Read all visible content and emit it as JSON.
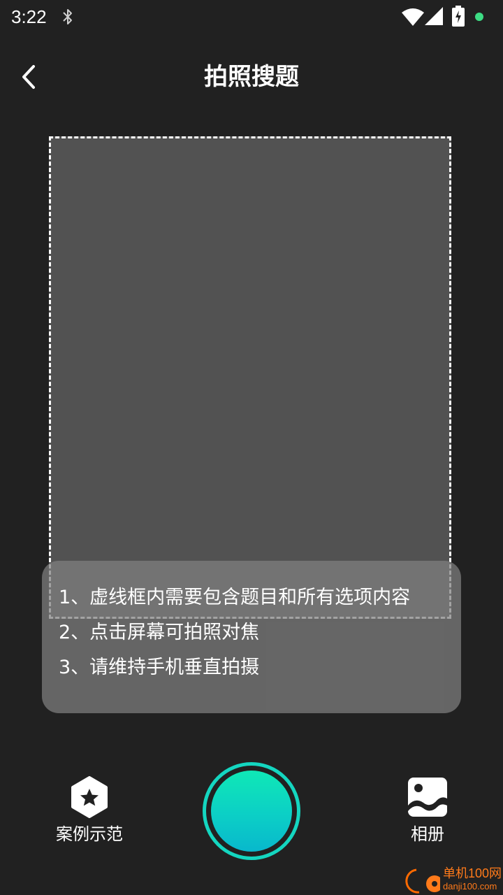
{
  "status_bar": {
    "time": "3:22",
    "icons": [
      "bluetooth-icon",
      "wifi-icon",
      "cell-signal-icon",
      "battery-charging-icon"
    ],
    "notification_dot_color": "#3ddc84"
  },
  "header": {
    "title": "拍照搜题",
    "back_icon": "chevron-left-icon"
  },
  "tips": [
    "1、虚线框内需要包含题目和所有选项内容",
    "2、点击屏幕可拍照对焦",
    "3、请维持手机垂直拍摄"
  ],
  "bottom_bar": {
    "example_label": "案例示范",
    "example_icon": "star-badge-icon",
    "album_label": "相册",
    "album_icon": "photo-album-icon",
    "shutter_icon": "shutter-icon"
  },
  "colors": {
    "background": "#212121",
    "frame": "#525252",
    "accent": "#14d6c0"
  },
  "watermark": {
    "name": "单机100网",
    "url": "danji100.com"
  }
}
